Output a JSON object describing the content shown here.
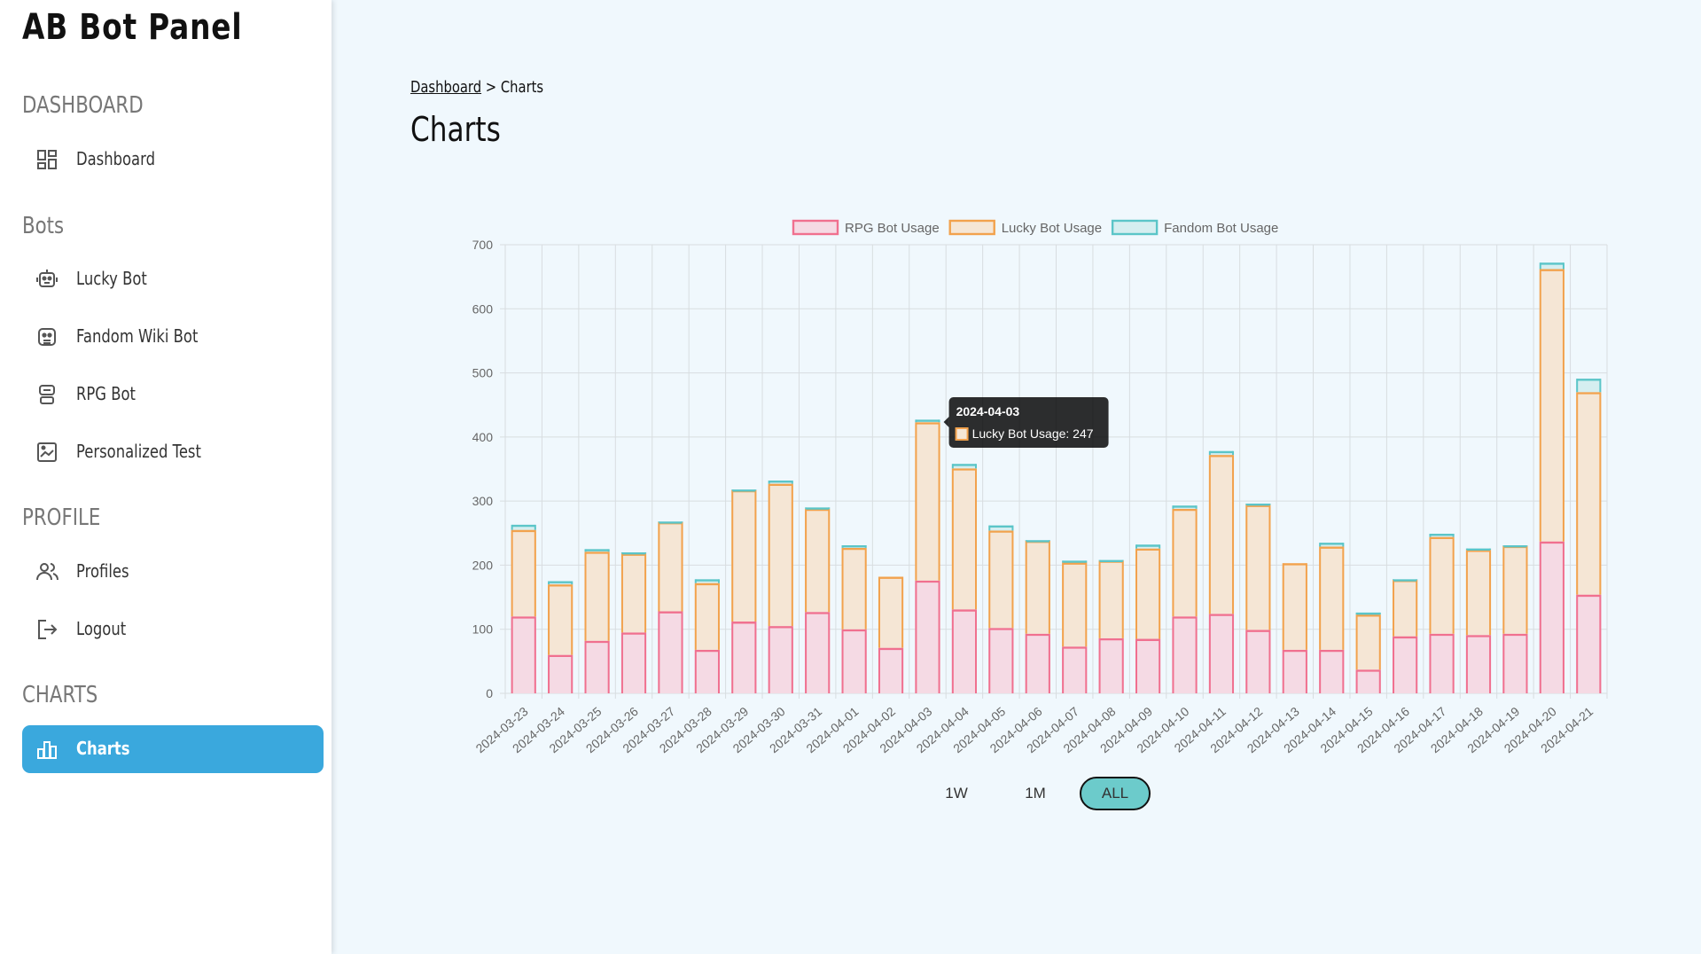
{
  "app": {
    "title": "AB Bot Panel"
  },
  "sidebar": {
    "sections": [
      {
        "heading": "DASHBOARD",
        "items": [
          {
            "label": "Dashboard",
            "icon": "dashboard-icon"
          }
        ]
      },
      {
        "heading": "Bots",
        "items": [
          {
            "label": "Lucky Bot",
            "icon": "robot-icon"
          },
          {
            "label": "Fandom Wiki Bot",
            "icon": "robot-face-icon"
          },
          {
            "label": "RPG Bot",
            "icon": "robot-head-icon"
          },
          {
            "label": "Personalized Test",
            "icon": "image-frame-icon"
          }
        ]
      },
      {
        "heading": "PROFILE",
        "items": [
          {
            "label": "Profiles",
            "icon": "users-icon"
          },
          {
            "label": "Logout",
            "icon": "logout-icon"
          }
        ]
      },
      {
        "heading": "CHARTS",
        "items": [
          {
            "label": "Charts",
            "icon": "bar-chart-icon",
            "active": true
          }
        ]
      }
    ],
    "active_color": "#3aa8dd"
  },
  "breadcrumb": {
    "link": "Dashboard",
    "separator": ">",
    "current": "Charts"
  },
  "page": {
    "title": "Charts"
  },
  "range_buttons": [
    {
      "label": "1W",
      "active": false
    },
    {
      "label": "1M",
      "active": false
    },
    {
      "label": "ALL",
      "active": true
    }
  ],
  "tooltip": {
    "title": "2024-04-03",
    "text": "Lucky Bot Usage: 247",
    "category_index": 11,
    "series_index": 1
  },
  "chart_data": {
    "type": "bar",
    "stacked": true,
    "legend": "top-center",
    "grid": true,
    "ylim": [
      0,
      700
    ],
    "yticks": [
      0,
      100,
      200,
      300,
      400,
      500,
      600,
      700
    ],
    "categories": [
      "2024-03-23",
      "2024-03-24",
      "2024-03-25",
      "2024-03-26",
      "2024-03-27",
      "2024-03-28",
      "2024-03-29",
      "2024-03-30",
      "2024-03-31",
      "2024-04-01",
      "2024-04-02",
      "2024-04-03",
      "2024-04-04",
      "2024-04-05",
      "2024-04-06",
      "2024-04-07",
      "2024-04-08",
      "2024-04-09",
      "2024-04-10",
      "2024-04-11",
      "2024-04-12",
      "2024-04-13",
      "2024-04-14",
      "2024-04-15",
      "2024-04-16",
      "2024-04-17",
      "2024-04-18",
      "2024-04-19",
      "2024-04-20",
      "2024-04-21"
    ],
    "series": [
      {
        "name": "RPG Bot Usage",
        "border": "#f0708f",
        "fill": "#f5dae4",
        "values": [
          120,
          60,
          82,
          95,
          128,
          68,
          112,
          105,
          127,
          100,
          71,
          176,
          131,
          102,
          93,
          73,
          86,
          85,
          120,
          124,
          99,
          68,
          68,
          37,
          89,
          93,
          91,
          93,
          237,
          154
        ]
      },
      {
        "name": "Lucky Bot Usage",
        "border": "#f2a24d",
        "fill": "#f5e6d5",
        "values": [
          135,
          110,
          139,
          123,
          139,
          104,
          205,
          222,
          161,
          127,
          111,
          247,
          220,
          152,
          145,
          131,
          121,
          141,
          168,
          248,
          195,
          135,
          161,
          86,
          88,
          151,
          133,
          137,
          425,
          316
        ]
      },
      {
        "name": "Fandom Bot Usage",
        "border": "#5bc5c8",
        "fill": "#d5eef0",
        "values": [
          8,
          5,
          4,
          2,
          1,
          6,
          1,
          5,
          2,
          4,
          0,
          4,
          7,
          8,
          1,
          3,
          1,
          6,
          5,
          6,
          2,
          0,
          6,
          3,
          1,
          5,
          2,
          1,
          10,
          21
        ]
      }
    ]
  }
}
